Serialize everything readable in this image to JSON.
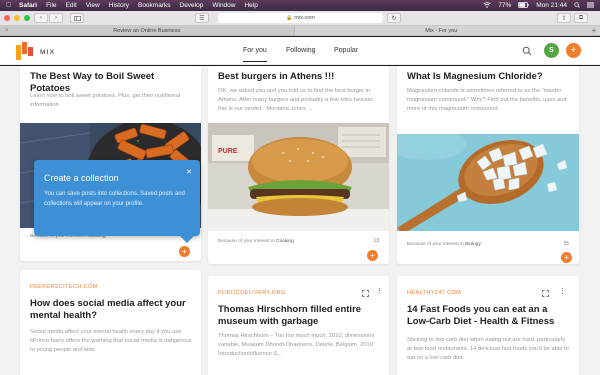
{
  "menubar": {
    "app": "Safari",
    "items": [
      "File",
      "Edit",
      "View",
      "History",
      "Bookmarks",
      "Develop",
      "Window",
      "Help"
    ],
    "battery": "77%",
    "clock": "Mon 21:44"
  },
  "browser": {
    "address": "mix.com",
    "tabs": [
      "Review an Online Business",
      "Mix - For you"
    ]
  },
  "app": {
    "brand": "MIX",
    "nav": [
      "For you",
      "Following",
      "Popular"
    ],
    "avatar_letter": "S",
    "add_symbol": "+"
  },
  "cards": [
    {
      "title": "The Best Way to Boil Sweet Potatoes",
      "excerpt": "Learn how to boil sweet potatoes. Plus, get their nutritional information.",
      "because_prefix": "Because of your interest in",
      "interest": "Cooking",
      "count": "",
      "plus": "+"
    },
    {
      "title": "Best burgers in Athens !!!",
      "excerpt": "OK, we asked you and you told us to find the best burger in Athens. After many burgers and probably a few kilos heavier, this is our verdict : Montana Jones ...",
      "because_prefix": "Because of your interest in",
      "interest": "Cooking",
      "count": "13",
      "plus": "+"
    },
    {
      "title": "What Is Magnesium Chloride?",
      "excerpt": "Magnesium chloride is sometimes referred to as the \"master magnesium compound.\" Why? Find out the benefits, uses and more of this magnesium compound.",
      "because_prefix": "Because of your interest in",
      "interest": "Biology",
      "count": "15",
      "plus": "+"
    },
    {
      "domain": "PEEKERSCITECH.COM",
      "title": "How does social media affect your mental health?",
      "excerpt": "Social media affect your mental health every day if you use itPrince harry offers the warning that social media is dangerous to young people and kids"
    },
    {
      "domain": "PUBLICDELIVERY.ORG",
      "title": "Thomas Hirschhorn filled entire museum with garbage",
      "excerpt": "Thomas Hirschhorn – Too too much much, 2010, dimensions variable, Museum Dhondt-Dhaenens, Deurle, Belgium, 2010 IntroductionInfluence S..."
    },
    {
      "domain": "HEALTHY247.COM",
      "title": "14 Fast Foods you can eat an a Low-Carb Diet - Health & Fitness",
      "excerpt": "Sticking to low-carb diet when eating out are hard, particularly at fast-food restaurants. 14 delicious fast foods you'll be able to eat on a low-carb diet."
    }
  ],
  "tooltip": {
    "title": "Create a collection",
    "body": "You can save posts into collections. Saved posts and collections will appear on your profile.",
    "close": "✕"
  }
}
